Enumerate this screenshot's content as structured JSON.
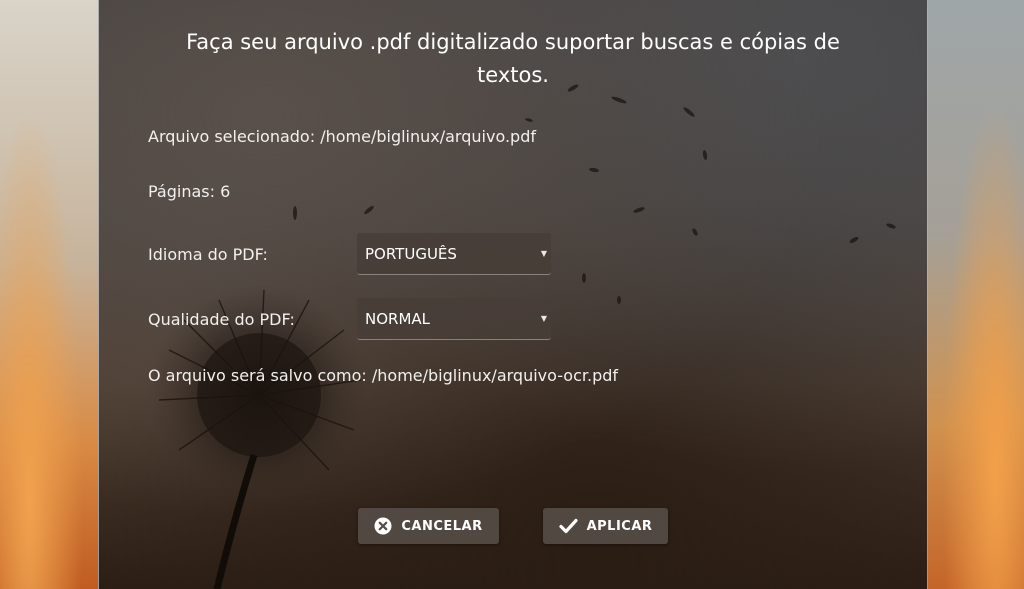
{
  "dialog": {
    "title": "Faça seu arquivo .pdf digitalizado suportar buscas e cópias de textos."
  },
  "info": {
    "selected_file": "Arquivo selecionado: /home/biglinux/arquivo.pdf",
    "pages": "Páginas: 6",
    "output_file": "O arquivo será salvo como: /home/biglinux/arquivo-ocr.pdf"
  },
  "form": {
    "language_label": "Idioma do PDF:",
    "language_value": "PORTUGUÊS",
    "quality_label": "Qualidade do PDF:",
    "quality_value": "NORMAL"
  },
  "buttons": {
    "cancel_label": "CANCELAR",
    "apply_label": "APLICAR"
  },
  "icons": {
    "cancel": "close-circle-icon",
    "apply": "check-icon",
    "dropdown": "caret-down-icon"
  }
}
